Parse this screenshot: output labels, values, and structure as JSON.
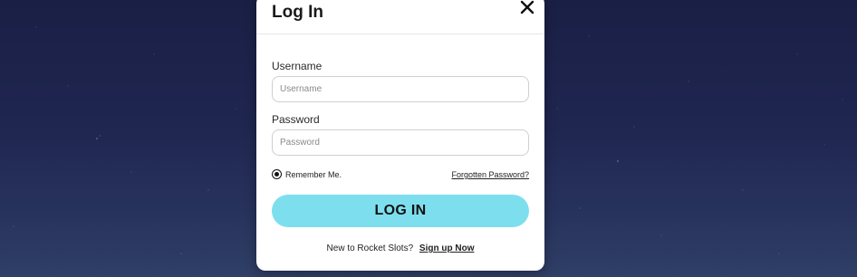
{
  "modal": {
    "title": "Log In",
    "close_icon": "close-icon"
  },
  "form": {
    "username_label": "Username",
    "username_placeholder": "Username",
    "password_label": "Password",
    "password_placeholder": "Password",
    "remember_label": "Remember Me.",
    "remember_checked": true,
    "forgot_label": "Forgotten Password?",
    "login_button_label": "LOG IN"
  },
  "footer": {
    "prompt": "New to Rocket Slots?",
    "signup_label": "Sign up Now"
  },
  "colors": {
    "login_button": "#7ddfee",
    "background_top": "#1a1f45",
    "background_bottom": "#2f3f66"
  }
}
